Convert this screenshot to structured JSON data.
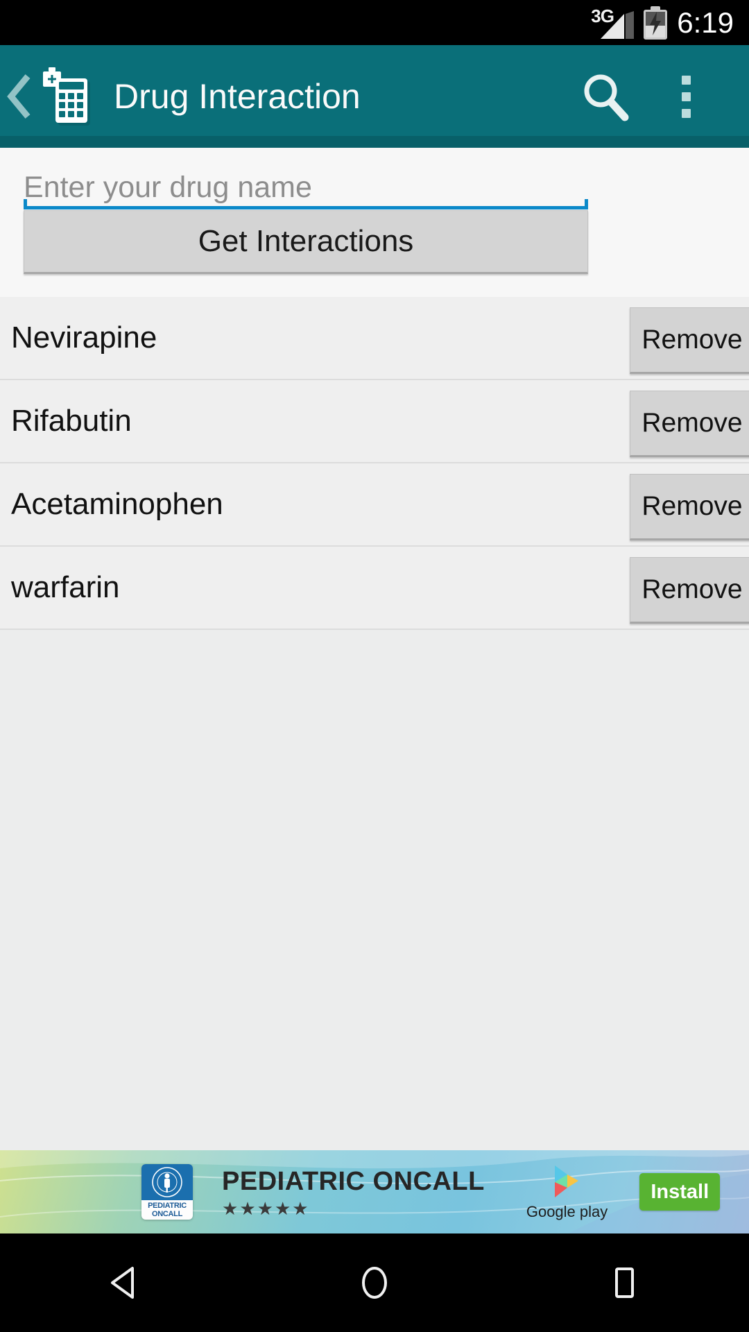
{
  "status_bar": {
    "network_label": "3G",
    "signal_icon": "signal-bars-icon",
    "battery_icon": "battery-charging-icon",
    "time": "6:19"
  },
  "action_bar": {
    "back_icon": "back-chevron-icon",
    "app_icon": "calculator-medkit-icon",
    "title": "Drug Interaction",
    "search_icon": "search-icon",
    "overflow_icon": "overflow-menu-icon",
    "accent_color": "#0a6f79"
  },
  "form": {
    "drug_input": {
      "value": "",
      "placeholder": "Enter your drug name",
      "underline_color": "#0b89c9"
    },
    "get_interactions_label": "Get Interactions"
  },
  "drug_list": {
    "remove_label": "Remove",
    "items": [
      {
        "name": "Nevirapine"
      },
      {
        "name": "Rifabutin"
      },
      {
        "name": "Acetaminophen"
      },
      {
        "name": "warfarin"
      }
    ]
  },
  "ad": {
    "logo_line1": "PEDIATRIC",
    "logo_line2": "ONCALL",
    "title": "PEDIATRIC ONCALL",
    "rating": "★★★★★",
    "stars": 5,
    "store_label": "Google play",
    "store_icon": "google-play-icon",
    "install_label": "Install",
    "install_color": "#58b332"
  },
  "nav_bar": {
    "back_icon": "nav-back-triangle-icon",
    "home_icon": "nav-home-circle-icon",
    "recents_icon": "nav-recents-square-icon"
  }
}
